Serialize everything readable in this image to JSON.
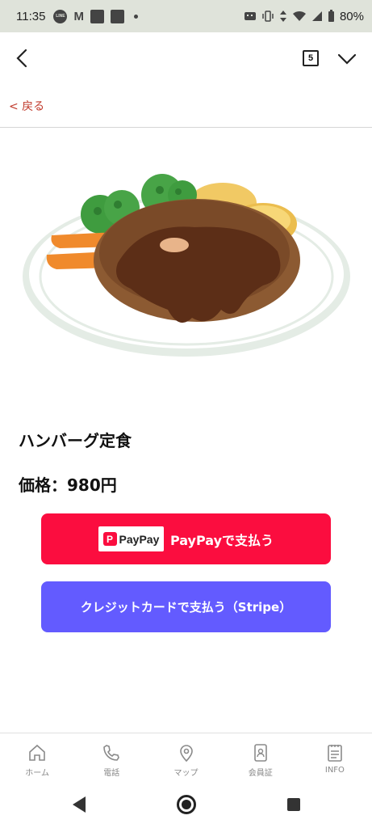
{
  "status_bar": {
    "time": "11:35",
    "line_label": "LINE",
    "gmail_label": "M",
    "battery": "80%"
  },
  "header": {
    "tab_count": "5"
  },
  "back_link": "< 戻る",
  "item": {
    "name": "ハンバーグ定食",
    "price": "価格：980円"
  },
  "buttons": {
    "paypay_logo_text": "PayPay",
    "paypay_label": "PayPayで支払う",
    "stripe_label": "クレジットカードで支払う（Stripe）"
  },
  "colors": {
    "paypay": "#fb0d3f",
    "stripe": "#635bff",
    "back_link": "#c0392b"
  },
  "bottom_nav": [
    {
      "label": "ホーム",
      "icon": "home-icon"
    },
    {
      "label": "電話",
      "icon": "phone-icon"
    },
    {
      "label": "マップ",
      "icon": "map-pin-icon"
    },
    {
      "label": "会員証",
      "icon": "member-card-icon"
    },
    {
      "label": "INFO",
      "icon": "info-list-icon"
    }
  ]
}
